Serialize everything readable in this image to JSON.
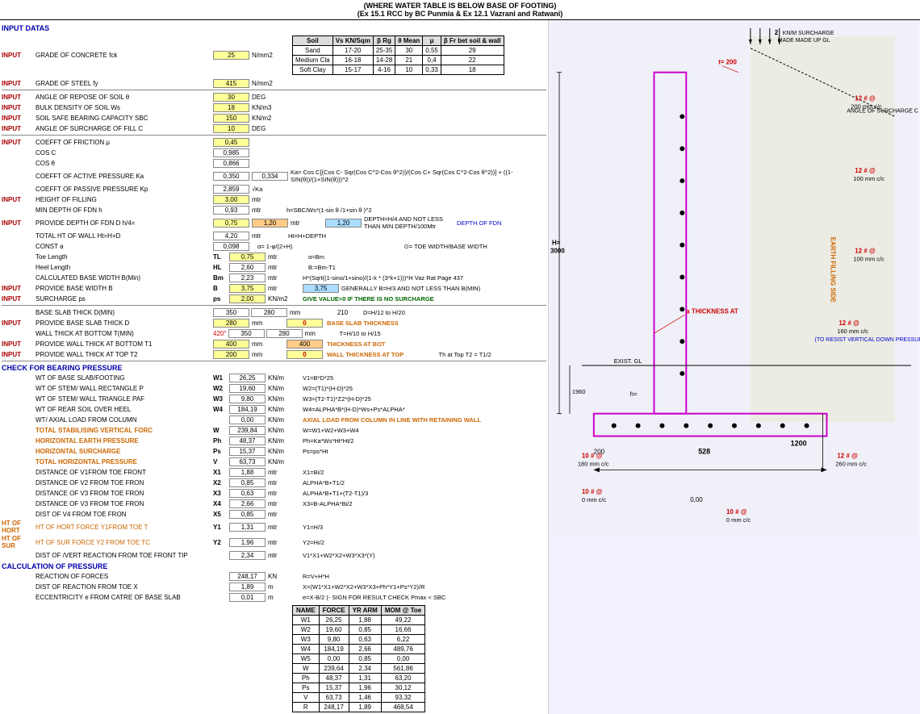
{
  "header": {
    "line1": "(WHERE WATER TABLE IS BELOW BASE OF FOOTING)",
    "line2": "(Ex 15.1 RCC by BC Punmia & Ex 12.1 Vazrani and Ratwani)"
  },
  "sections": {
    "input_data": "INPUT DATAS",
    "check_bearing": "CHECK FOR BEARING PRESSURE",
    "calc_pressure": "CALCULATION OF PRESSURE"
  },
  "inputs": {
    "fck_label": "GRADE OF CONCRETE   fck",
    "fck_value": "25",
    "fck_unit": "N/mm2",
    "fy_label": "GRADE OF STEEL   fy",
    "fy_value": "415",
    "fy_unit": "N/mm2",
    "repose_label": "ANGLE OF REPOSE OF SOIL θ",
    "repose_value": "30",
    "repose_unit": "DEG",
    "bulk_label": "BULK DENSITY OF SOIL Ws",
    "bulk_value": "18",
    "bulk_unit": "KN/m3",
    "sbc_label": "SOIL SAFE BEARING CAPACITY SBC",
    "sbc_value": "150",
    "sbc_unit": "KN/m2",
    "surcharge_fill_label": "ANGLE OF SURCHARGE OF FILL C",
    "surcharge_fill_value": "10",
    "surcharge_fill_unit": "DEG",
    "mu_label": "COEFFT OF FRICTION μ",
    "mu_value": "0,45",
    "cos_c_label": "COS C",
    "cos_c_value": "0,985",
    "cos_theta_label": "COS θ",
    "cos_theta_value": "0,866",
    "ka_label": "COEFFT OF ACTIVE PRESSURE Ka",
    "ka_value": "0,350",
    "ka_value2": "0,334",
    "kp_label": "COEFFT OF PASSIVE PRESSURE Kp",
    "kp_value": "2,859",
    "height_filling_label": "HEIGHT OF FILLING",
    "height_filling_value": "3,00",
    "height_filling_unit": "mtr",
    "min_depth_label": "MIN DEPTH OF FDN   h",
    "min_depth_value": "0,93",
    "min_depth_unit": "mtr",
    "provide_depth_label": "PROVIDE DEPTH OF FDN   D   h/4=",
    "provide_depth_val1": "0,75",
    "provide_depth_val2": "1,20",
    "provide_depth_unit": "mtr",
    "provide_depth_val3": "1,20",
    "total_ht_label": "TOTAL HT OF WALL Ht=H+D",
    "total_ht_value": "4,20",
    "total_ht_unit": "mtr",
    "const_a_label": "CONST a",
    "const_a_value": "0,098",
    "toe_length_label": "Toe Length",
    "toe_tl": "TL",
    "toe_length_value": "0,75",
    "toe_length_unit": "mtr",
    "heel_length_label": "Heel Length",
    "heel_hl": "HL",
    "heel_length_value": "2,60",
    "heel_length_unit": "mtr",
    "calc_base_label": "CALCULATED BASE WIDTH  B(Min)",
    "calc_base_bm": "Bm",
    "calc_base_value": "2,23",
    "calc_base_unit": "mtr",
    "provide_base_label": "PROVIDE BASE WIDTH   B",
    "provide_base_b": "B",
    "provide_base_value": "3,75",
    "provide_base_unit": "mtr",
    "provide_base_val2": "3,75",
    "surcharge_ps_label": "SURCHARGE   ps",
    "surcharge_ps": "ps",
    "surcharge_value": "2,00",
    "surcharge_unit": "KN/m2",
    "base_slab_min_label": "BASE SLAB THICK D(MIN)",
    "base_slab_min_v1": "350",
    "base_slab_min_v2": "280",
    "base_slab_min_unit": "mm",
    "base_slab_calc": "210",
    "provide_base_slab_label": "PROVIDE BASE SLAB THICK D",
    "provide_base_slab_value": "280",
    "provide_base_slab_unit": "mm",
    "provide_base_slab_v2": "0",
    "wall_thick_bot_label": "WALL THICK AT BOTTOM  T(MIN)",
    "wall_thick_bot_420": "420°",
    "wall_thick_bot_v1": "350",
    "wall_thick_bot_v2": "280",
    "wall_thick_bot_unit": "mm",
    "provide_wall_bot_label": "PROVIDE WALL THICK AT BOTTOM  T1",
    "provide_wall_bot_value": "400",
    "provide_wall_bot_unit": "mm",
    "provide_wall_bot_v2": "400",
    "provide_wall_top_label": "PROVIDE WALL THICK AT TOP T2",
    "provide_wall_top_value": "200",
    "provide_wall_top_unit": "mm",
    "provide_wall_top_v2": "0"
  },
  "soil_table": {
    "headers": [
      "Soil",
      "Vs KN/Sqm",
      "β Rg",
      "θ Mean",
      "μ",
      "β Fr bet soil & wall"
    ],
    "rows": [
      [
        "Sand",
        "17-20",
        "25-35",
        "30",
        "0,55",
        "29"
      ],
      [
        "Medium Cla",
        "16-18",
        "14-28",
        "21",
        "0,4",
        "22"
      ],
      [
        "Soft Clay",
        "15-17",
        "4-16",
        "10",
        "0,33",
        "18"
      ]
    ]
  },
  "check_bearing": {
    "w1_label": "WT OF  BASE SLAB/FOOTING",
    "w1_id": "W1",
    "w1_value": "26,25",
    "w1_unit": "KN/m",
    "w2_label": "WT OF  STEM/ WALL  RECTANGLE P",
    "w2_id": "W2",
    "w2_value": "19,60",
    "w2_unit": "KN/m",
    "w3_label": "WT OF  STEM/ WALL  TRIANGLE PAF",
    "w3_id": "W3",
    "w3_value": "9,80",
    "w3_unit": "KN/m",
    "w4_label": "WT OF REAR SOIL OVER HEEL",
    "w4_id": "W4",
    "w4_value": "184,19",
    "w4_unit": "KN/m",
    "wt_axial_label": "WT/ AXIAL LOAD FROM COLUMN",
    "wt_axial_value": "0,00",
    "wt_axial_unit": "KN/m",
    "total_stab_label": "TOTAL STABILISING VERTICAL FORC",
    "total_stab_id": "W",
    "total_stab_value": "239,84",
    "total_stab_unit": "KN/m",
    "horiz_earth_label": "HORIZONTAL EARTH PRESSURE",
    "horiz_earth_id": "Ph",
    "horiz_earth_value": "48,37",
    "horiz_earth_unit": "KN/m",
    "horiz_surch_label": "HORIZONTAL SURCHARGE",
    "horiz_surch_id": "Ps",
    "horiz_surch_value": "15,37",
    "horiz_surch_unit": "KN/m",
    "total_horiz_label": "TOTAL HORIZONTAL PRESSURE",
    "total_horiz_id": "V",
    "total_horiz_value": "63,73",
    "total_horiz_unit": "KN/m",
    "dist_v1_label": "DISTANCE OF V1FROM TOE FRONT",
    "dist_v1_id": "X1",
    "dist_v1_value": "1,88",
    "dist_v1_unit": "mtr",
    "dist_v2_label": "DISTANCE OF  V2 FROM TOE FRON",
    "dist_v2_id": "X2",
    "dist_v2_value": "0,85",
    "dist_v2_unit": "mtr",
    "dist_v3_label": "DISTANCE OF  V3 FROM TOE FRON",
    "dist_v3_id": "X3",
    "dist_v3_value": "0,63",
    "dist_v3_unit": "mtr",
    "dist_v3b_label": "DISTANCE OF  V3 FROM   TOE FRON",
    "dist_v3b_id": "X4",
    "dist_v3b_value": "2,66",
    "dist_v3b_unit": "mtr",
    "dist_v4_label": "DIST OF  V4 FROM  TOE FRON",
    "dist_v4_id": "X5",
    "dist_v4_value": "0,85",
    "dist_v4_unit": "mtr",
    "ht_horiz_label": "HT OF HORT FORCE Y1FROM TOE T",
    "ht_horiz_id": "Y1",
    "ht_horiz_value": "1,31",
    "ht_horiz_unit": "mtr",
    "ht_surf_label": "HT OF SUR FORCE Y2 FROM TOE TC",
    "ht_surf_id": "Y2",
    "ht_surf_value": "1,96",
    "ht_surf_unit": "mtr",
    "dist_vert_label": "DIST OF /VERT REACTION FROM TOE FRONT TIP",
    "dist_vert_value": "2,34",
    "dist_vert_unit": "mtr"
  },
  "calc_pressure": {
    "reaction_label": "REACTION OF FORCES",
    "reaction_value": "248,17",
    "reaction_unit": "KN",
    "dist_reaction_label": "DIST OF REACTION FROM TOE X",
    "dist_reaction_value": "1,89",
    "dist_reaction_unit": "m",
    "eccentricity_label": "ECCENTRICITY e FROM CATRE OF BASE SLAB",
    "eccentricity_value": "0,01",
    "eccentricity_unit": "m"
  },
  "results_table": {
    "headers": [
      "NAME",
      "FORCE",
      "YR ARM",
      "MOM @ Toe"
    ],
    "rows": [
      [
        "W1",
        "26,25",
        "1,88",
        "49,22"
      ],
      [
        "W2",
        "19,60",
        "0,85",
        "16,66"
      ],
      [
        "W3",
        "9,80",
        "0,63",
        "6,22"
      ],
      [
        "W4",
        "184,19",
        "2,66",
        "489,76"
      ],
      [
        "W5",
        "0,00",
        "0,85",
        "0,00"
      ],
      [
        "W",
        "239,64",
        "2,34",
        "561,86"
      ],
      [
        "Ph",
        "48,37",
        "1,31",
        "63,20"
      ],
      [
        "Ps",
        "15,37",
        "1,96",
        "30,12"
      ],
      [
        "V",
        "63,73",
        "1,46",
        "93,32"
      ],
      [
        "R",
        "248,17",
        "1,89",
        "468,54"
      ]
    ]
  },
  "formulas": {
    "ka_formula": "Ka= Cos C[(Cos C- Sqr(Cos C^2-Cos θ^2))/(Cos C+ Sqr(Cos C^2-Cos θ^2))] + ((1-SIN(θ))/(1+SIN(θ)))^2",
    "vka": "√Ka",
    "h_formula": "h=SBC/Ws*(1-sin θ /1+sin θ )^2",
    "depth_formula": "DEPTH=H/4 AND NOT LESS THAN MIN DEPTH/100Mtr",
    "depth_of_fdn": "DEPTH OF FDN",
    "const_a_formula": "α= 1-φ/(2+H)",
    "toe_formula": "α=Bm",
    "heel_formula": "B:=Bm-T1",
    "calc_base_formula": "H*(Sqrt((1-sino/1+sino)/(1-k * (3*k+1)))*H Vaz Rat Page 437",
    "provide_base_formula": "GENERALLY B=H/3 AND NOT LESS THAN B(MIN)",
    "surcharge_note": "GIVE VALUE=0 IF THERE IS NO SURCHARGE",
    "base_slab_formula": "D=H/12  to  H/20",
    "provide_base_note": "BASE SLAB THICKNESS",
    "wall_thick_note": "THICKNESS AT BOT",
    "wall_thick_formula": "T=H/10 to H/15",
    "wall_thick_at_top": "WALL THICKNESS AT TOP",
    "wall_top_formula": "Th at Top T2 = T1/2",
    "w1_formula": "V1=B*D*25",
    "w2_formula": "W2=(T1)*(H-D)*25",
    "w3_formula": "W3=(T2-T1)*Z2*(H-D)*25",
    "w4_formula": "W4=ALPHA*B*(H-D)*Ws+Ps*ALPHA*",
    "axial_formula": "AXIAL LOAD FROM COLUMN IN LINE WITH RETAINING WALL",
    "w_formula": "W=W1+W2+W3+W4",
    "ph_formula": "Ph=Ka*Ws*Ht*Ht/2",
    "ps_formula": "Ps=ps*Ht",
    "x1_formula": "X1=Bi/2",
    "x2_formula": "ALPHA*B+T1/2",
    "x3_formula": "ALPHA*B+T1+(T2-T1)/3",
    "x4_formula": "X3=B-ALPHA*Bi/2",
    "y1_formula": "Y1=H/3",
    "y2_formula": "Y2=Hi/2",
    "dist_formula": "V1*X1+W2*X2+W3*X3*(Y)",
    "r_formula": "R=V+H*H",
    "x_formula": "X=(W1*X1+W2*X2+W3*X3+Ph*Y1+Ps*Y2)/R",
    "check_formula": "e=X-B/2 (- SIGN FOR RESULT CHECK  Pmax < SBC",
    "thickness_at_label": "a THICKNESS AT"
  },
  "drawing": {
    "h_value": "H=",
    "h_num": "3000",
    "t_value": "t=  200",
    "exist_gl": "EXIST. GL",
    "gl_value": "1960",
    "h_equals": "h=",
    "val_1200": "1200",
    "val_200": "200",
    "val_528": "528",
    "val_0": "0,00",
    "knm_surcharge": "KN/M SURCHARGE",
    "made_up_gl": "MADE MADE UP GL",
    "angle_surcharge": "ANGLE OF SURCHARGE C",
    "earth_filling": "EARTH FILLING SIDE",
    "rebar_12_200_1": "12 # @",
    "rebar_200_1": "200 mm c/c",
    "rebar_12_100": "12 # @",
    "rebar_100": "100 mm c/c",
    "rebar_12_100_2": "12 # @",
    "rebar_100_2": "100 mm c/c",
    "rebar_12_160": "12 # @",
    "rebar_160": "160 mm c/c",
    "resist_note": "(TO RESIST VERTICAL DOWN PRESSURE)",
    "rebar_10_180_1": "10 # @",
    "rebar_180_1": "180 mm c/c",
    "rebar_10_260": "10 # @",
    "rebar_260": "260 mm c/c",
    "rebar_12_260": "12 # @",
    "rebar_0": "0  mm c/c",
    "rebar_10_0": "10 # @",
    "rebar_0_2": "0  mm c/c",
    "val_2": "2",
    "val_260": "260 mm c/c"
  }
}
